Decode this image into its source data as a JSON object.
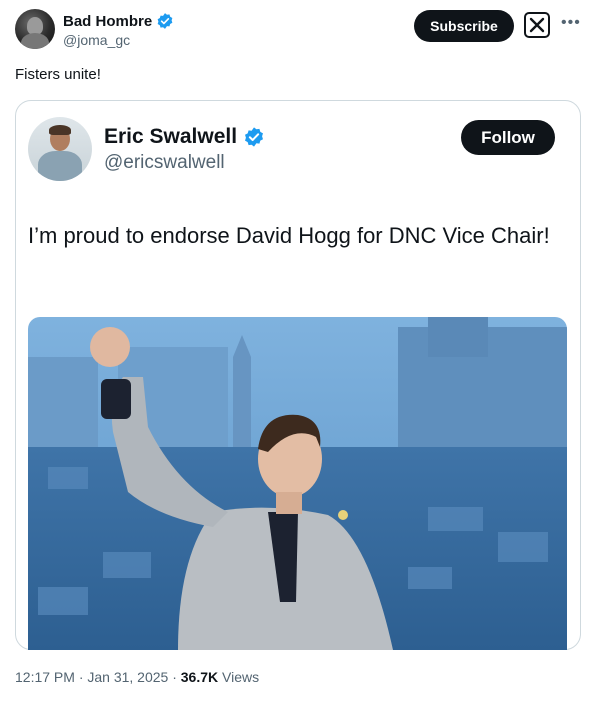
{
  "author": {
    "name": "Bad Hombre",
    "handle": "@joma_gc"
  },
  "actions": {
    "subscribe_label": "Subscribe",
    "x_logo": "x-logo-icon",
    "more_icon": "ellipsis-icon"
  },
  "post_text": "Fisters unite!",
  "quoted": {
    "name": "Eric Swalwell",
    "handle": "@ericswalwell",
    "follow_label": "Follow",
    "text": "I’m proud to endorse David Hogg for DNC Vice Chair!"
  },
  "meta": {
    "time": "12:17 PM · Jan 31, 2025 · ",
    "views_count": "36.7K",
    "views_label": " Views"
  },
  "colors": {
    "verified": "#1d9bf0",
    "text_primary": "#0f1419",
    "text_secondary": "#536471",
    "photo_tint": "#4a86bf"
  }
}
